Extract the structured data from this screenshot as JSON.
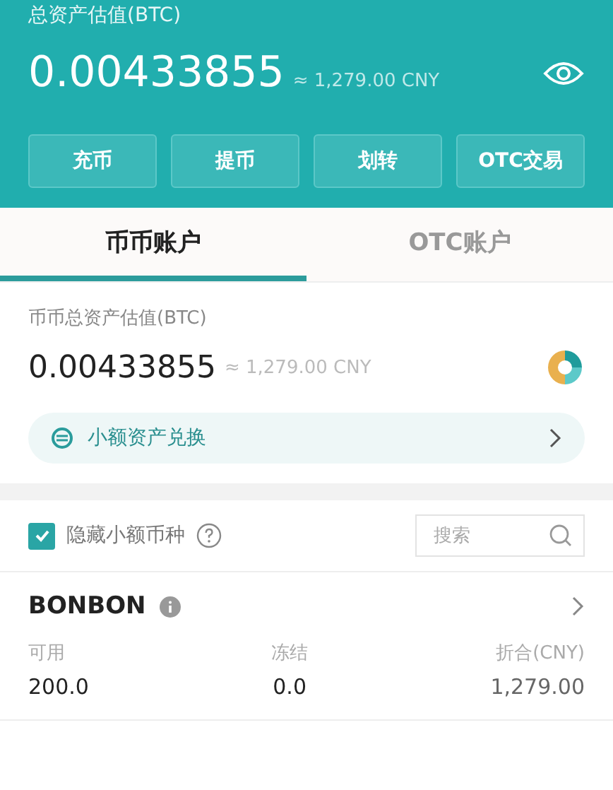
{
  "header": {
    "title": "总资产估值(BTC)",
    "amount": "0.00433855",
    "approx": "≈ 1,279.00 CNY"
  },
  "actions": [
    "充币",
    "提币",
    "划转",
    "OTC交易"
  ],
  "tabs": [
    {
      "label": "币币账户",
      "selected": true
    },
    {
      "label": "OTC账户",
      "selected": false
    }
  ],
  "account": {
    "title": "币币总资产估值(BTC)",
    "amount": "0.00433855",
    "approx": "≈ 1,279.00 CNY",
    "exchange_link": "小额资产兑换"
  },
  "filter": {
    "label": "隐藏小额币种",
    "checked": true,
    "search_placeholder": "搜索"
  },
  "coins": [
    {
      "name": "BONBON",
      "columns": [
        {
          "label": "可用",
          "value": "200.0"
        },
        {
          "label": "冻结",
          "value": "0.0"
        },
        {
          "label": "折合(CNY)",
          "value": "1,279.00"
        }
      ]
    }
  ]
}
